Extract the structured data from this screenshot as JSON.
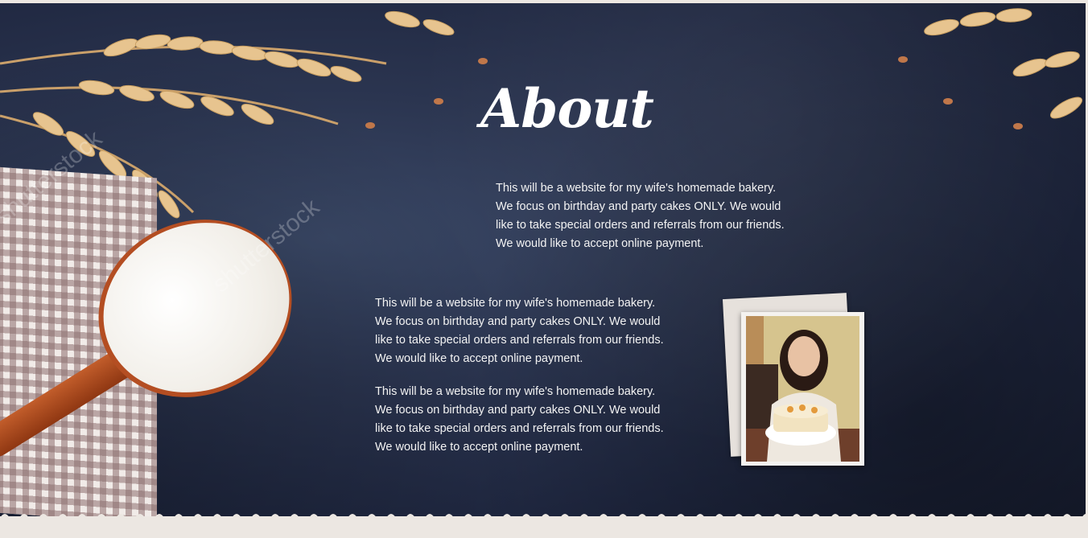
{
  "section": {
    "title": "About"
  },
  "paragraphs": [
    {
      "lines": [
        "This will be a website for my wife's homemade bakery.",
        "We focus on birthday and party cakes ONLY. We would",
        "like to take special orders and referrals from our friends.",
        "We would like to accept online payment."
      ]
    },
    {
      "lines": [
        "This will be a website for my wife's homemade bakery.",
        "We focus on birthday and party cakes ONLY. We would",
        "like to take special orders and referrals from our friends.",
        "We would like to accept online payment."
      ]
    },
    {
      "lines": [
        "This will be a website for my wife's homemade bakery.",
        "We focus on birthday and party cakes ONLY. We would",
        "like to take special orders and referrals from our friends.",
        "We would like to accept online payment."
      ]
    }
  ],
  "decor": {
    "watermark_1": "shutterstock",
    "watermark_2": "shutterstock"
  },
  "colors": {
    "board": "#2b3550",
    "text": "#f3f3f3",
    "spoon": "#b44e22"
  }
}
